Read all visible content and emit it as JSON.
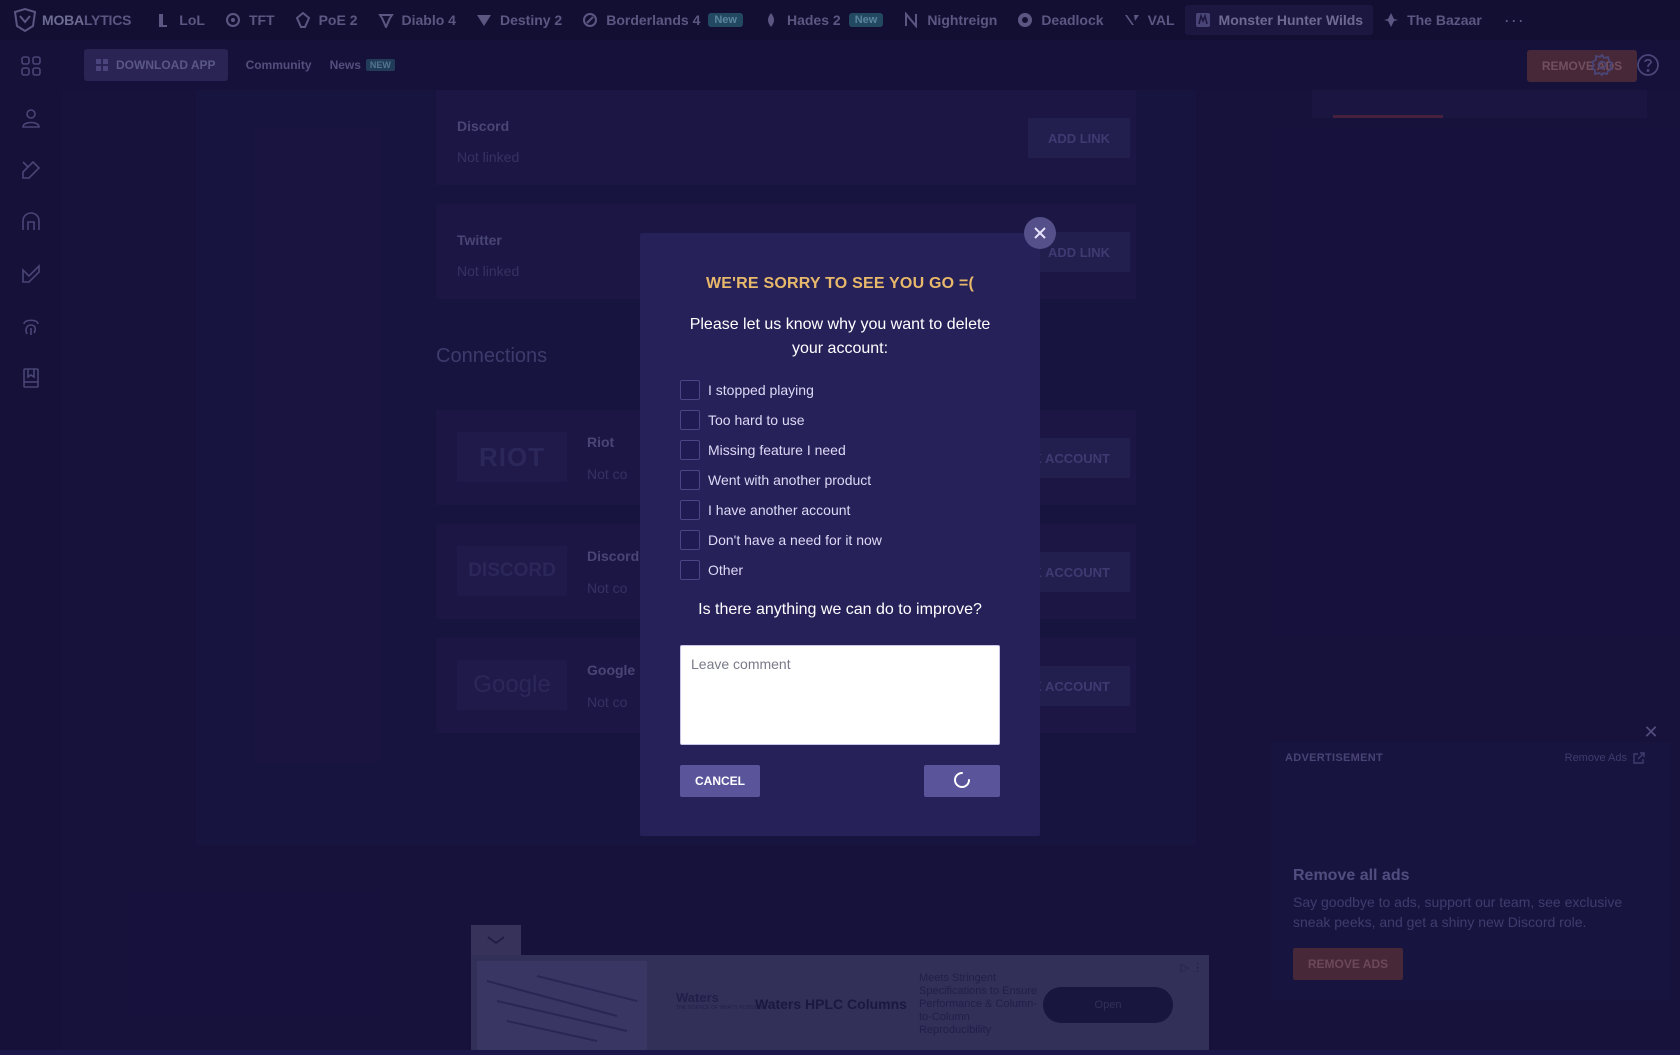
{
  "topnav": {
    "logo": {
      "prefix": "MOBA",
      "suffix": "LYTICS"
    },
    "games": [
      {
        "label": "LoL",
        "icon": "lol-icon",
        "badge": ""
      },
      {
        "label": "TFT",
        "icon": "tft-icon",
        "badge": ""
      },
      {
        "label": "PoE 2",
        "icon": "poe-icon",
        "badge": ""
      },
      {
        "label": "Diablo 4",
        "icon": "diablo-icon",
        "badge": ""
      },
      {
        "label": "Destiny 2",
        "icon": "destiny-icon",
        "badge": ""
      },
      {
        "label": "Borderlands 4",
        "icon": "borderlands-icon",
        "badge": "New"
      },
      {
        "label": "Hades 2",
        "icon": "hades-icon",
        "badge": "New"
      },
      {
        "label": "Nightreign",
        "icon": "nightreign-icon",
        "badge": ""
      },
      {
        "label": "Deadlock",
        "icon": "deadlock-icon",
        "badge": ""
      },
      {
        "label": "VAL",
        "icon": "valorant-icon",
        "badge": ""
      },
      {
        "label": "Monster Hunter Wilds",
        "icon": "monster-hunter-icon",
        "badge": ""
      },
      {
        "label": "The Bazaar",
        "icon": "bazaar-icon",
        "badge": ""
      }
    ],
    "more": "···"
  },
  "subheader": {
    "download": "DOWNLOAD APP",
    "community": "Community",
    "news": "News",
    "news_badge": "NEW",
    "remove_ads": "REMOVE ADS"
  },
  "links": [
    {
      "title": "Discord",
      "status": "Not linked",
      "button": "ADD LINK"
    },
    {
      "title": "Twitter",
      "status": "Not linked",
      "button": "ADD LINK"
    }
  ],
  "connections": {
    "title": "Connections",
    "items": [
      {
        "name": "Riot",
        "logo": "RIOT",
        "status": "Not co",
        "button": "K ACCOUNT"
      },
      {
        "name": "Discord",
        "logo": "DISCORD",
        "status": "Not co",
        "button": "K ACCOUNT"
      },
      {
        "name": "Google",
        "logo": "Google",
        "status": "Not co",
        "button": "K ACCOUNT"
      }
    ]
  },
  "side_ad": {
    "label": "ADVERTISEMENT",
    "remove_link": "Remove Ads",
    "heading": "Remove all ads",
    "copy": "Say goodbye to ads, support our team, see exclusive sneak peeks, and get a shiny new Discord role.",
    "button": "REMOVE ADS"
  },
  "bottom_ad": {
    "brand": "Waters",
    "brand_tagline": "THE SCIENCE OF WHAT'S POSSIBLE",
    "title": "Waters HPLC Columns",
    "description": "Meets Stringent Specifications to Ensure Performance & Column-to-Column Reproducibility",
    "open": "Open"
  },
  "modal": {
    "title": "WE'RE SORRY TO SEE YOU GO =(",
    "subtitle": "Please let us know why you want to delete your account:",
    "reasons": [
      "I stopped playing",
      "Too hard to use",
      "Missing feature I need",
      "Went with another product",
      "I have another account",
      "Don't have a need for it now",
      "Other"
    ],
    "improve": "Is there anything we can do to improve?",
    "comment_placeholder": "Leave comment",
    "cancel": "CANCEL"
  }
}
